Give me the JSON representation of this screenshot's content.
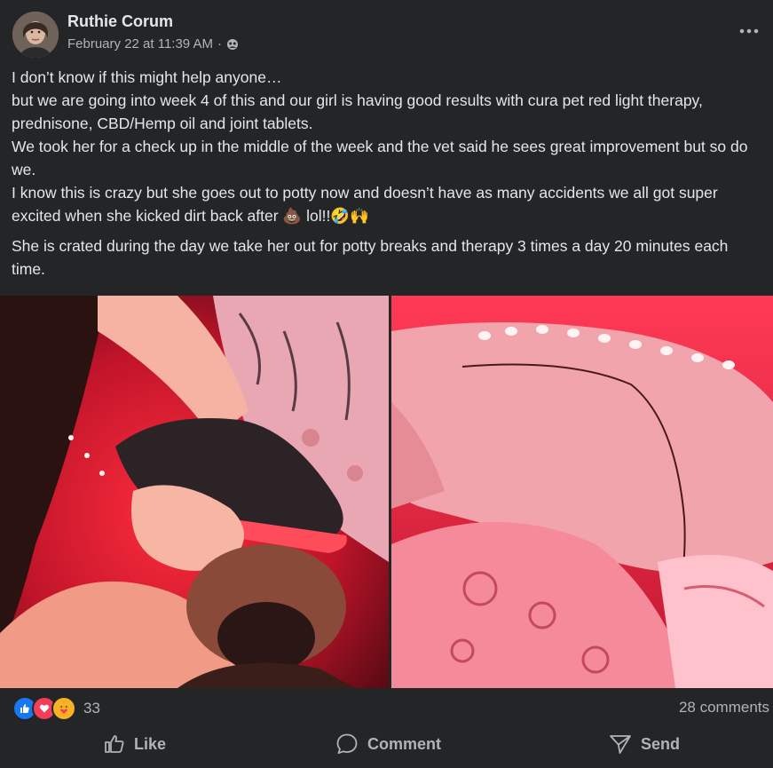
{
  "post": {
    "author": "Ruthie Corum",
    "timestamp": "February 22 at 11:39 AM",
    "separator": "·",
    "paragraphs": [
      "I don’t know if this might help anyone…",
      "but we are going into week 4 of this and our girl is having good results with cura pet red light therapy, prednisone, CBD/Hemp oil and joint tablets.",
      "We took her for a check up in the middle of the week and the vet said he sees great improvement but so do we.",
      "I know this is crazy but she goes out to potty now and doesn’t have as many accidents we all got super excited when she kicked dirt back after 💩 lol!!🤣🙌"
    ],
    "paragraph_after_gap": "She is crated during the day we take her out for potty breaks and therapy 3 times a day 20 minutes each time."
  },
  "icons": {
    "more": "more-options-icon",
    "privacy": "globe-friends-icon",
    "like": "thumbs-up-icon",
    "comment": "speech-bubble-icon",
    "send": "send-arrow-icon"
  },
  "engagement": {
    "reaction_count": "33",
    "comments": "28 comments"
  },
  "actions": {
    "like": "Like",
    "comment": "Comment",
    "send": "Send"
  },
  "colors": {
    "background": "#242526",
    "text_primary": "#e4e6eb",
    "text_secondary": "#b0b3b8",
    "like_blue": "#1877f2",
    "love_red": "#f33e58",
    "care_yellow": "#f7b125"
  }
}
